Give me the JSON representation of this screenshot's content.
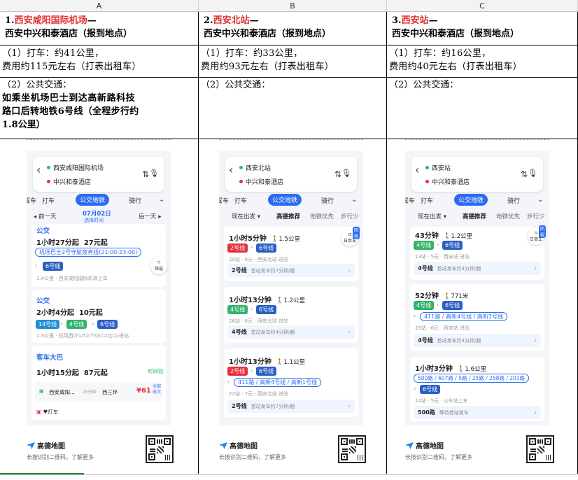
{
  "columns": [
    "A",
    "B",
    "C"
  ],
  "row1": [
    {
      "num": "1.",
      "place": "西安咸阳国际机场",
      "dash": "—",
      "line2": "西安中兴和泰酒店（报到地点）"
    },
    {
      "num": "2.",
      "place": "西安北站",
      "dash": "—",
      "line2": "西安中兴和泰酒店（报到地点）"
    },
    {
      "num": "3.",
      "place": "西安站",
      "dash": "—",
      "line2": "西安中兴和泰酒店（报到地点）"
    }
  ],
  "row2": [
    {
      "l1": "（1）打车：约41公里，",
      "l2": "费用约115元左右（打表出租车）"
    },
    {
      "l1": "（1）打车：约33公里，",
      "l2": "费用约93元左右（打表出租车）"
    },
    {
      "l1": "（1）打车：约16公里，",
      "l2": "费用约40元左右（打表出租车）"
    }
  ],
  "row3": [
    {
      "l1": "（2）公共交通：",
      "l2": "如乘坐机场巴士到达高新路科技",
      "l3": "路口后转地铁6号线（全程步行约",
      "l4": "1.8公里）"
    },
    {
      "l1": "（2）公共交通："
    },
    {
      "l1": "（2）公共交通："
    }
  ],
  "phones": [
    {
      "from": "西安咸阳国际机场",
      "to": "中兴和泰酒店",
      "modes": [
        "驾车",
        "打车",
        "公交地铁",
        "骑行"
      ],
      "prev": "◂ 前一天",
      "date": "07月02日",
      "date_sub": "选择时间",
      "next": "后一天 ▸",
      "sec1": "公交",
      "c1_title": "1小时27分起",
      "c1_price": "27元起",
      "c1_bus": "机场巴士2号守航夜宵线(21:00-23:00)",
      "c1_line": "6号线",
      "c1_walk": "1.4公里 · 西安咸阳国际机场上车",
      "filter": "筛选",
      "sec2": "公交",
      "c2_title": "2小时4分起",
      "c2_price": "10元起",
      "c2_l1": "14号线",
      "c2_l2": "4号线",
      "c2_l3": "6号线",
      "c2_walk": "1.3公里 · 机场西(T1/T2/T3)(C2北口)进站",
      "sec3": "客车大巴",
      "c3_title": "1小时15分起",
      "c3_price": "87元起",
      "c3_tag": "时间短",
      "c3_from": "西安咸阳...",
      "c3_dur": "25分钟",
      "c3_to": "西三环",
      "c3_fare": "¥61",
      "c3_all": "全部班次",
      "c3_taxi": "打车"
    },
    {
      "from": "西安北站",
      "to": "中兴和泰酒店",
      "modes": [
        "驾车",
        "打车",
        "公交地铁",
        "骑行"
      ],
      "sub": [
        "现在出发 ▾",
        "高德推荐",
        "地铁优先",
        "步行少"
      ],
      "hail": "日单车",
      "hail_tag": "回程",
      "c1_title": "1小时5分钟",
      "c1_walk": "1.5公里",
      "c1_l1": "2号线",
      "c1_l2": "6号线",
      "c1_info": "20站 · 6元 · 西安北站 进站",
      "c1_bar_line": "2号线",
      "c1_bar_text": "首站发车约7分钟/趟",
      "c2_title": "1小时13分钟",
      "c2_walk": "1.2公里",
      "c2_l1": "4号线",
      "c2_l2": "6号线",
      "c2_info": "26站 · 6元 · 西安北站 进站",
      "c2_bar_line": "4号线",
      "c2_bar_text": "首站发车约4分钟/趟",
      "c3_title": "1小时13分钟",
      "c3_walk": "1.1公里",
      "c3_l1": "2号线",
      "c3_l2": "6号线",
      "c3_bus": "411路 / 高新4号线 / 高新1号线",
      "c3_info": "22站 · 7元 · 西安北站 进站",
      "c3_bar_line": "2号线",
      "c3_bar_text": "首站发车约7分钟/趟"
    },
    {
      "from": "西安站",
      "to": "中兴和泰酒店",
      "modes": [
        "驾车",
        "打车",
        "公交地铁",
        "骑行"
      ],
      "sub": [
        "现在出发 ▾",
        "高德推荐",
        "地铁优先",
        "步行少"
      ],
      "hail": "日单车",
      "hail_tag": "回程",
      "c1_title": "43分钟",
      "c1_walk": "1.2公里",
      "c1_l1": "4号线",
      "c1_l2": "6号线",
      "c1_info": "13站 · 5元 · 西安站 进站",
      "c1_bar_line": "4号线",
      "c1_bar_text": "首站发车约4分钟/趟",
      "c2_title": "52分钟",
      "c2_walk": "771米",
      "c2_l1": "4号线",
      "c2_l2": "6号线",
      "c2_bus": "411路 / 高新4号线 / 高新1号线",
      "c2_info": "15站 · 6元 · 西安站 进站",
      "c2_bar_line": "4号线",
      "c2_bar_text": "首站发车约4分钟/趟",
      "c3_title": "1小时3分钟",
      "c3_walk": "1.6公里",
      "c3_bus": "500路 / 607路 / 5路 / 25路 / 258路 / 201路",
      "c3_line": "6号线",
      "c3_info": "14站 · 5元 · 火车站上车",
      "c3_bar_line": "500路",
      "c3_bar_text": "等待首站发车"
    }
  ],
  "footer": {
    "brand": "高德地图",
    "hint": "长按识别二维码，了解更多"
  },
  "colors": {
    "accent": "#2d6cf0",
    "red": "#e03030",
    "line2": "#e6303b",
    "line4": "#33b36b",
    "line6": "#2c5fc3"
  }
}
